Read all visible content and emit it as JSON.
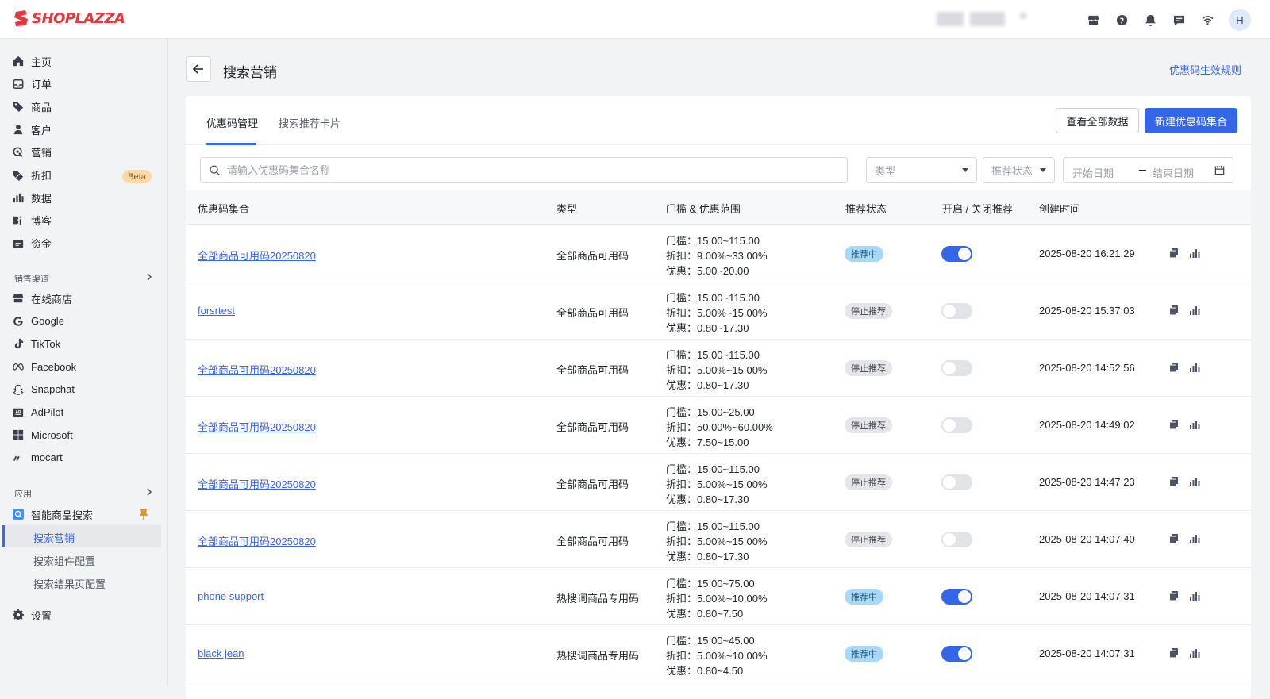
{
  "brand": {
    "name": "SHOPLAZZA",
    "color": "#e8373c"
  },
  "topbar": {
    "icons": [
      "store-icon",
      "help-icon",
      "bell-icon",
      "message-icon",
      "wifi-icon"
    ],
    "avatar_initial": "H"
  },
  "sidebar": {
    "main_items": [
      {
        "label": "主页",
        "icon": "home-icon"
      },
      {
        "label": "订单",
        "icon": "inbox-icon"
      },
      {
        "label": "商品",
        "icon": "tag-icon"
      },
      {
        "label": "客户",
        "icon": "person-icon"
      },
      {
        "label": "营销",
        "icon": "marketing-icon"
      },
      {
        "label": "折扣",
        "icon": "discount-icon"
      },
      {
        "label": "数据",
        "icon": "bar-chart-icon"
      },
      {
        "label": "博客",
        "icon": "blog-icon"
      },
      {
        "label": "资金",
        "icon": "wallet-icon"
      }
    ],
    "beta_label": "Beta",
    "channels_title": "销售渠道",
    "channels": [
      {
        "label": "在线商店",
        "icon": "store-icon"
      },
      {
        "label": "Google",
        "icon": "google-icon"
      },
      {
        "label": "TikTok",
        "icon": "tiktok-icon"
      },
      {
        "label": "Facebook",
        "icon": "meta-icon"
      },
      {
        "label": "Snapchat",
        "icon": "snapchat-icon"
      },
      {
        "label": "AdPilot",
        "icon": "adpilot-icon"
      },
      {
        "label": "Microsoft",
        "icon": "microsoft-icon"
      },
      {
        "label": "mocart",
        "icon": "mocart-icon"
      }
    ],
    "apps_title": "应用",
    "app": {
      "label": "智能商品搜索",
      "icon": "search-app-icon"
    },
    "app_sub_items": [
      "搜索营销",
      "搜索组件配置",
      "搜索结果页配置"
    ],
    "active_sub_item": "搜索营销",
    "settings_label": "设置"
  },
  "page": {
    "title": "搜索营销",
    "rule_link": "优惠码生效规则",
    "tabs": [
      "优惠码管理",
      "搜索推荐卡片"
    ],
    "active_tab": "优惠码管理",
    "view_all_button": "查看全部数据",
    "new_button": "新建优惠码集合",
    "search_placeholder": "请输入优惠码集合名称",
    "filter_type": "类型",
    "filter_status": "推荐状态",
    "start_date": "开始日期",
    "end_date": "结束日期",
    "accent_color": "#3566e8"
  },
  "table": {
    "columns": [
      "优惠码集合",
      "类型",
      "门槛 & 优惠范围",
      "推荐状态",
      "开启 / 关闭推荐",
      "创建时间"
    ],
    "rows": [
      {
        "name": "全部商品可用码20250820",
        "type": "全部商品可用码",
        "threshold": "门槛：15.00~115.00",
        "discount": "折扣：9.00%~33.00%",
        "offer": "优惠：5.00~20.00",
        "status": "推荐中",
        "enabled": true,
        "created": "2025-08-20 16:21:29"
      },
      {
        "name": "forsrtest",
        "type": "全部商品可用码",
        "threshold": "门槛：15.00~115.00",
        "discount": "折扣：5.00%~15.00%",
        "offer": "优惠：0.80~17.30",
        "status": "停止推荐",
        "enabled": false,
        "created": "2025-08-20 15:37:03"
      },
      {
        "name": "全部商品可用码20250820",
        "type": "全部商品可用码",
        "threshold": "门槛：15.00~115.00",
        "discount": "折扣：5.00%~15.00%",
        "offer": "优惠：0.80~17.30",
        "status": "停止推荐",
        "enabled": false,
        "created": "2025-08-20 14:52:56"
      },
      {
        "name": "全部商品可用码20250820",
        "type": "全部商品可用码",
        "threshold": "门槛：15.00~25.00",
        "discount": "折扣：50.00%~60.00%",
        "offer": "优惠：7.50~15.00",
        "status": "停止推荐",
        "enabled": false,
        "created": "2025-08-20 14:49:02"
      },
      {
        "name": "全部商品可用码20250820",
        "type": "全部商品可用码",
        "threshold": "门槛：15.00~115.00",
        "discount": "折扣：5.00%~15.00%",
        "offer": "优惠：0.80~17.30",
        "status": "停止推荐",
        "enabled": false,
        "created": "2025-08-20 14:47:23"
      },
      {
        "name": "全部商品可用码20250820",
        "type": "全部商品可用码",
        "threshold": "门槛：15.00~115.00",
        "discount": "折扣：5.00%~15.00%",
        "offer": "优惠：0.80~17.30",
        "status": "停止推荐",
        "enabled": false,
        "created": "2025-08-20 14:07:40"
      },
      {
        "name": "phone support",
        "type": "热搜词商品专用码",
        "threshold": "门槛：15.00~75.00",
        "discount": "折扣：5.00%~10.00%",
        "offer": "优惠：0.80~7.50",
        "status": "推荐中",
        "enabled": true,
        "created": "2025-08-20 14:07:31"
      },
      {
        "name": "black jean",
        "type": "热搜词商品专用码",
        "threshold": "门槛：15.00~45.00",
        "discount": "折扣：5.00%~10.00%",
        "offer": "优惠：0.80~4.50",
        "status": "推荐中",
        "enabled": true,
        "created": "2025-08-20 14:07:31"
      }
    ],
    "row_actions": [
      "copy-icon",
      "stats-icon"
    ]
  }
}
